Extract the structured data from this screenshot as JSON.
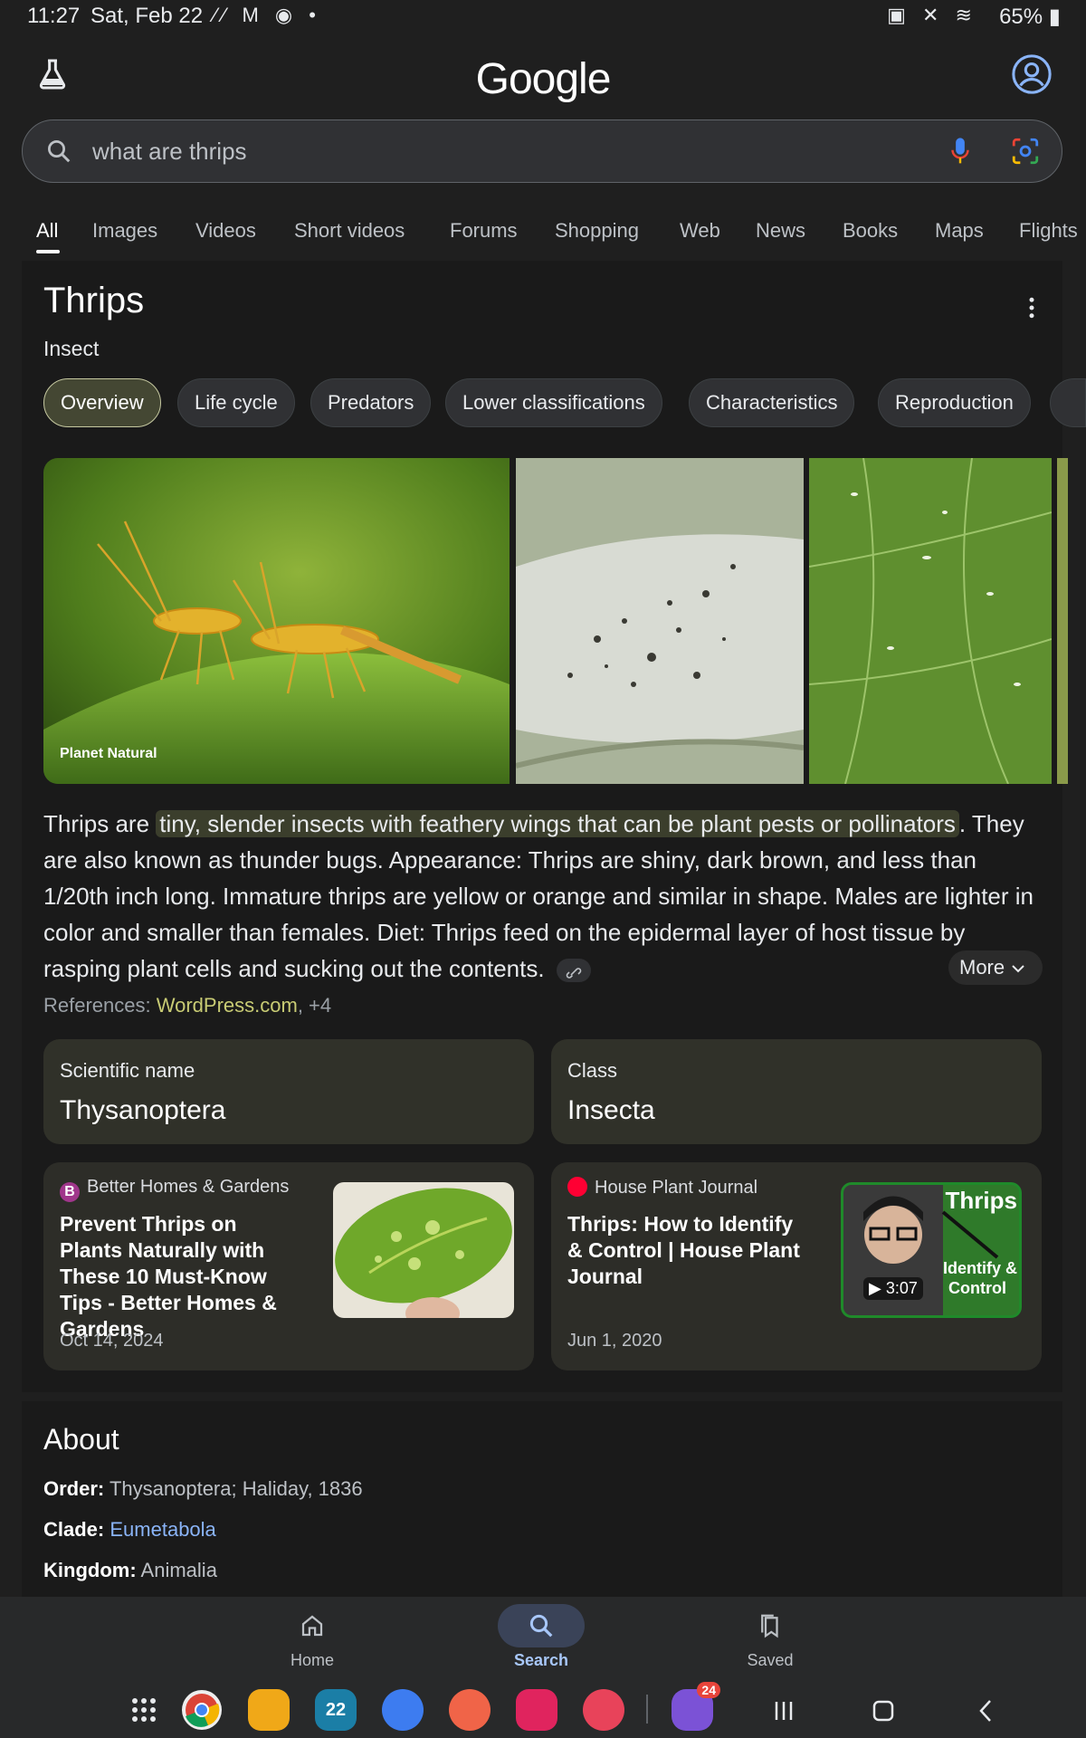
{
  "status_bar": {
    "time": "11:27",
    "date": "Sat, Feb 22",
    "battery": "65%"
  },
  "header": {
    "logo": "Google"
  },
  "search": {
    "query": "what are thrips"
  },
  "tabs": [
    "All",
    "Images",
    "Videos",
    "Short videos",
    "Forums",
    "Shopping",
    "Web",
    "News",
    "Books",
    "Maps",
    "Flights"
  ],
  "knowledge_panel": {
    "title": "Thrips",
    "subtitle": "Insect",
    "chips": [
      "Overview",
      "Life cycle",
      "Predators",
      "Lower classifications",
      "Characteristics",
      "Reproduction"
    ],
    "image_source": "Planet Natural",
    "description_before": "Thrips are ",
    "description_highlight": "tiny, slender insects with feathery wings that can be plant pests or pollinators",
    "description_after": ". They are also known as thunder bugs. Appearance: Thrips are shiny, dark brown, and less than 1/20th inch long. Immature thrips are yellow or orange and similar in shape. Males are lighter in color and smaller than females. Diet: Thrips feed on the epidermal layer of host tissue by rasping plant cells and sucking out the contents.",
    "more_label": "More",
    "references_label": "References: ",
    "references_link": "WordPress.com",
    "references_extra": ", +4",
    "facts": [
      {
        "label": "Scientific name",
        "value": "Thysanoptera"
      },
      {
        "label": "Class",
        "value": "Insecta"
      }
    ],
    "articles": [
      {
        "source": "Better Homes & Gardens",
        "favicon_letter": "B",
        "title": "Prevent Thrips on Plants Naturally with These 10 Must-Know Tips - Better Homes & Gardens",
        "date": "Oct 14, 2024"
      },
      {
        "source": "House Plant Journal",
        "title": "Thrips: How to Identify & Control | House Plant Journal",
        "date": "Jun 1, 2020",
        "video_duration": "3:07",
        "thumb_text_1": "Thrips",
        "thumb_text_2": "Identify &",
        "thumb_text_3": "Control"
      }
    ]
  },
  "about": {
    "title": "About",
    "rows": [
      {
        "key": "Order:",
        "value": " Thysanoptera; Haliday, 1836"
      },
      {
        "key": "Clade:",
        "value": "Eumetabola"
      },
      {
        "key": "Kingdom:",
        "value": " Animalia"
      }
    ]
  },
  "bottom_nav": [
    "Home",
    "Search",
    "Saved"
  ],
  "dock": {
    "calendar_day": "22",
    "badge": "24"
  },
  "colors": {
    "background": "#1f1f1f",
    "active_chip": "#444733",
    "highlight": "#3b3e2c",
    "link_green": "#c8cb74",
    "link_blue": "#8ab4f8",
    "nav_active": "#a8c7fa"
  },
  "icons": [
    "flask-icon",
    "account-icon",
    "search-icon",
    "mic-icon",
    "lens-icon",
    "more-vert-icon",
    "link-icon",
    "chevron-down-icon",
    "home-icon",
    "saved-icon",
    "play-icon"
  ]
}
